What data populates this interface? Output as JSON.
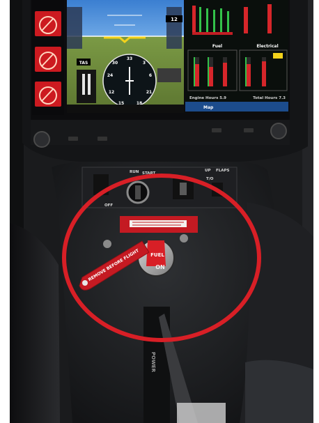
{
  "photo": {
    "subject": "cockpit-center-console",
    "accent_colors": {
      "warning_red": "#d81f26",
      "placard_red": "#c41a22",
      "sky_blue": "#5fa3e0",
      "ground_green": "#6f8a3b",
      "panel_black": "#141517",
      "screen_bezel": "#0c0c0e"
    }
  },
  "display": {
    "left_strip_icons": [
      "gauge-icon",
      "gauge-icon",
      "gauge-icon"
    ],
    "pfd": {
      "alt_readout": "12",
      "speed_label": "TAS",
      "hsi_numbers": [
        "33",
        "30",
        "3",
        "6",
        "21",
        "24",
        "12",
        "15",
        "18"
      ]
    },
    "mfd": {
      "fuel_title": "Fuel",
      "electrical_title": "Electrical",
      "engine_hours": "Engine Hours 5.9",
      "total_hours": "Total Hours 7.3"
    },
    "bottom_bar": "Map"
  },
  "console": {
    "switch_labels": [
      "RUN",
      "START",
      "OFF",
      "UP",
      "T/O",
      "FLAPS"
    ],
    "fuel_selector": {
      "label": "FUEL",
      "position": "ON",
      "placard_text": "REMOVE BEFORE FLIGHT"
    },
    "power_lever_label": "POWER",
    "highlight_shape": "red-ellipse"
  }
}
